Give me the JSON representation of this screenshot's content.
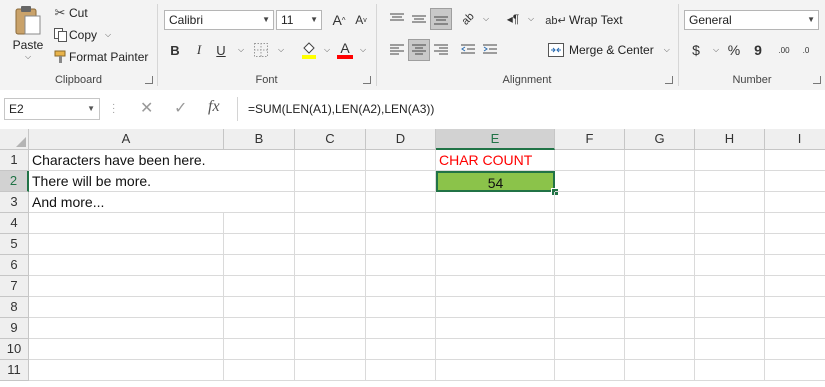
{
  "ribbon": {
    "clipboard": {
      "paste_label": "Paste",
      "cut_label": "Cut",
      "copy_label": "Copy",
      "format_painter_label": "Format Painter",
      "group_label": "Clipboard"
    },
    "font": {
      "font_name": "Calibri",
      "font_size": "11",
      "bold_label": "B",
      "italic_label": "I",
      "underline_label": "U",
      "grow_label": "A",
      "shrink_label": "A",
      "font_color_label": "A",
      "font_color": "#ff0000",
      "fill_color": "#ffff00",
      "group_label": "Font"
    },
    "alignment": {
      "wrap_text_label": "Wrap Text",
      "merge_center_label": "Merge & Center",
      "group_label": "Alignment"
    },
    "number": {
      "format": "General",
      "currency_label": "$",
      "percent_label": "%",
      "comma_label": "9",
      "inc_decimal_label": ".00",
      "dec_decimal_label": ".0",
      "group_label": "Number"
    }
  },
  "formula_bar": {
    "name_box": "E2",
    "cancel_label": "✕",
    "enter_label": "✓",
    "fx_label": "fx",
    "formula": "=SUM(LEN(A1),LEN(A2),LEN(A3))"
  },
  "grid": {
    "columns": [
      "A",
      "B",
      "C",
      "D",
      "E",
      "F",
      "G",
      "H",
      "I"
    ],
    "rows": [
      "1",
      "2",
      "3",
      "4",
      "5",
      "6",
      "7",
      "8",
      "9",
      "10",
      "11"
    ],
    "cells": {
      "A1": "Characters have been here.",
      "A2": "There will be more.",
      "A3": "And more...",
      "E1": "CHAR COUNT",
      "E2": "54"
    },
    "active_cell": "E2",
    "active_fill": "#8bc34a",
    "header_color": "#ff0000"
  }
}
